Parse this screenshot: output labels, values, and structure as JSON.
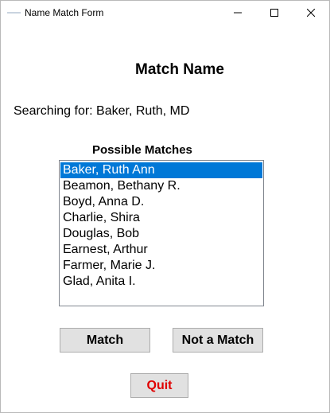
{
  "window": {
    "title": "Name Match Form",
    "controls": {
      "minimize_icon": "minimize-icon",
      "maximize_icon": "maximize-icon",
      "close_icon": "close-icon"
    }
  },
  "form": {
    "heading": "Match Name",
    "search_label": "Searching for: Baker, Ruth, MD",
    "list_heading": "Possible Matches",
    "matches": [
      {
        "name": "Baker, Ruth Ann",
        "selected": true
      },
      {
        "name": "Beamon, Bethany R.",
        "selected": false
      },
      {
        "name": "Boyd, Anna D.",
        "selected": false
      },
      {
        "name": "Charlie, Shira",
        "selected": false
      },
      {
        "name": "Douglas, Bob",
        "selected": false
      },
      {
        "name": "Earnest, Arthur",
        "selected": false
      },
      {
        "name": "Farmer, Marie J.",
        "selected": false
      },
      {
        "name": "Glad, Anita I.",
        "selected": false
      }
    ],
    "buttons": {
      "match": "Match",
      "not_match": "Not a Match",
      "quit": "Quit"
    }
  },
  "colors": {
    "selection": "#0078d7",
    "quit_text": "#e00000",
    "button_face": "#e1e1e1"
  }
}
